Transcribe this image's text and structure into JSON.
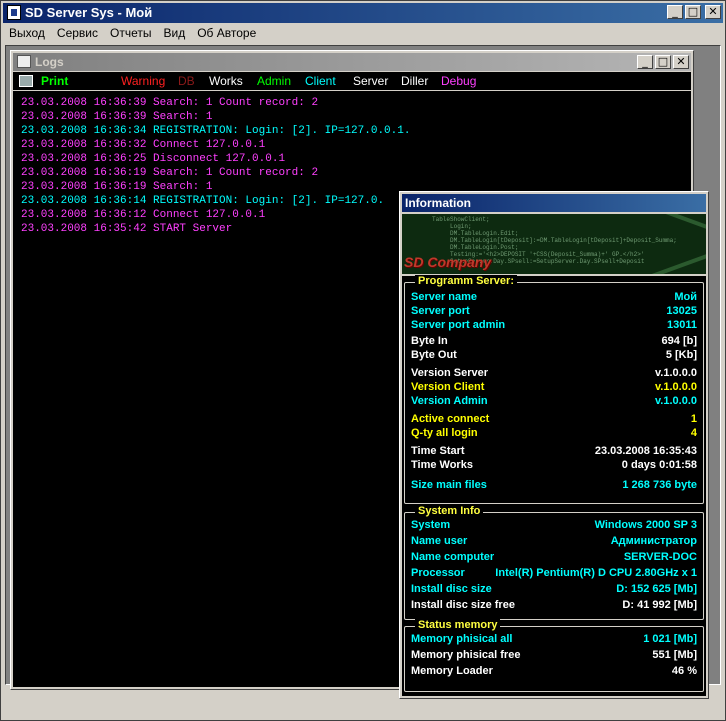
{
  "window": {
    "title": "SD Server Sys - Мой"
  },
  "menu": [
    "Выход",
    "Сервис",
    "Отчеты",
    "Вид",
    "Об Авторе"
  ],
  "logs_window": {
    "title": "Logs",
    "filters": [
      {
        "label": "Print",
        "color": "#00ff00"
      },
      {
        "label": "Warning",
        "color": "#ff2020"
      },
      {
        "label": "DB",
        "color": "#8b1a1a"
      },
      {
        "label": "Works",
        "color": "#ffffff"
      },
      {
        "label": "Admin",
        "color": "#00ff00"
      },
      {
        "label": "Client",
        "color": "#00ffff"
      },
      {
        "label": "Server",
        "color": "#ffffff"
      },
      {
        "label": "Diller",
        "color": "#ffffff"
      },
      {
        "label": "Debug",
        "color": "#ff40ff"
      }
    ],
    "lines": [
      {
        "text": "23.03.2008 16:36:39 Search: 1 Count record: 2",
        "color": "#ff40ff"
      },
      {
        "text": "23.03.2008 16:36:39 Search: 1",
        "color": "#ff40ff"
      },
      {
        "text": "23.03.2008 16:36:34 REGISTRATION: Login: [2]. IP=127.0.0.1.",
        "color": "#00ffff"
      },
      {
        "text": "23.03.2008 16:36:32 Connect 127.0.0.1",
        "color": "#ff40ff"
      },
      {
        "text": "23.03.2008 16:36:25 Disconnect 127.0.0.1",
        "color": "#ff40ff"
      },
      {
        "text": "23.03.2008 16:36:19 Search: 1 Count record: 2",
        "color": "#ff40ff"
      },
      {
        "text": "23.03.2008 16:36:19 Search: 1",
        "color": "#ff40ff"
      },
      {
        "text": "23.03.2008 16:36:14 REGISTRATION: Login: [2]. IP=127.0.",
        "color": "#00ffff"
      },
      {
        "text": "23.03.2008 16:36:12 Connect 127.0.0.1",
        "color": "#ff40ff"
      },
      {
        "text": "23.03.2008 16:35:42 START Server",
        "color": "#ff40ff"
      }
    ]
  },
  "info_window": {
    "title": "Information",
    "banner_logo": "SD Company",
    "banner_code": "TableShowClient;\n     Login;\n     DM.TableLogin.Edit;\n     DM.TableLogin[tDeposit]:=DM.TableLogin[tDeposit]+Deposit_Summa;\n     DM.TableLogin.Post;\n     Testing:='<h2>DEPOSIT '+CSS(Deposit_Summa)+' GP.</h2>'\n     SetupServer.Day.SPsell:=SetupServer.Day.SPsell+Deposit",
    "programm_server": {
      "legend": "Programm Server:",
      "rows": [
        {
          "k": "Server name",
          "v": "Мой",
          "color": "cyan"
        },
        {
          "k": "Server port",
          "v": "13025",
          "color": "cyan"
        },
        {
          "k": "Server port admin",
          "v": "13011",
          "color": "cyan"
        },
        {
          "k": "Byte In",
          "v": "694 [b]",
          "color": "white"
        },
        {
          "k": "Byte Out",
          "v": "5 [Kb]",
          "color": "white"
        },
        {
          "k": "Version Server",
          "v": "v.1.0.0.0",
          "color": "white"
        },
        {
          "k": "Version Client",
          "v": "v.1.0.0.0",
          "color": "yellow"
        },
        {
          "k": "Version Admin",
          "v": "v.1.0.0.0",
          "color": "cyan"
        },
        {
          "k": "Active connect",
          "v": "1",
          "color": "yellow"
        },
        {
          "k": "Q-ty all login",
          "v": "4",
          "color": "yellow"
        },
        {
          "k": "Time Start",
          "v": "23.03.2008 16:35:43",
          "color": "white"
        },
        {
          "k": "Time Works",
          "v": "0 days 0:01:58",
          "color": "white"
        },
        {
          "k": "Size main files",
          "v": "1 268 736 byte",
          "color": "cyan"
        }
      ]
    },
    "system_info": {
      "legend": "System Info",
      "rows": [
        {
          "k": "System",
          "v": "Windows 2000 SP 3",
          "color": "cyan"
        },
        {
          "k": "Name user",
          "v": "Администратор",
          "color": "cyan"
        },
        {
          "k": "Name computer",
          "v": "SERVER-DOC",
          "color": "cyan"
        },
        {
          "k": "Processor",
          "v": "Intel(R) Pentium(R) D CPU 2.80GHz x 1",
          "color": "cyan"
        },
        {
          "k": "Install disc size",
          "v": "D: 152 625 [Mb]",
          "color": "cyan"
        },
        {
          "k": "Install disc size free",
          "v": "D: 41 992 [Mb]",
          "color": "white"
        }
      ]
    },
    "status_memory": {
      "legend": "Status memory",
      "rows": [
        {
          "k": "Memory phisical all",
          "v": "1 021 [Mb]",
          "color": "cyan"
        },
        {
          "k": "Memory phisical free",
          "v": "551 [Mb]",
          "color": "white"
        },
        {
          "k": "Memory Loader",
          "v": "46 %",
          "color": "white"
        }
      ]
    }
  }
}
